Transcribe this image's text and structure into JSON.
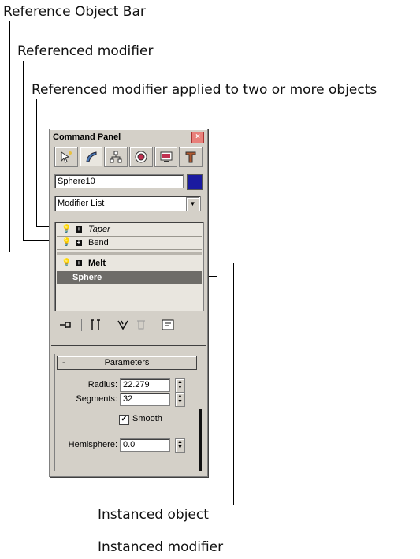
{
  "callouts": {
    "reference_object_bar": "Reference Object Bar",
    "referenced_modifier": "Referenced modifier",
    "referenced_modifier_multi": "Referenced modifier applied to two or more objects",
    "instanced_object": "Instanced object",
    "instanced_modifier": "Instanced modifier"
  },
  "panel": {
    "title": "Command Panel",
    "tabs": [
      "create-icon",
      "modify-icon",
      "hierarchy-icon",
      "motion-icon",
      "display-icon",
      "utilities-icon"
    ],
    "object_name": "Sphere10",
    "object_color": "#1a1aa0",
    "modifier_list": "Modifier List",
    "stack": {
      "taper": "Taper",
      "bend": "Bend",
      "melt": "Melt",
      "sphere": "Sphere"
    },
    "parameters": {
      "title": "Parameters",
      "collapse_symbol": "-",
      "radius_label": "Radius:",
      "radius_value": "22.279",
      "segments_label": "Segments:",
      "segments_value": "32",
      "smooth_label": "Smooth",
      "smooth_checked": true,
      "hemisphere_label": "Hemisphere:",
      "hemisphere_value": "0.0"
    }
  }
}
